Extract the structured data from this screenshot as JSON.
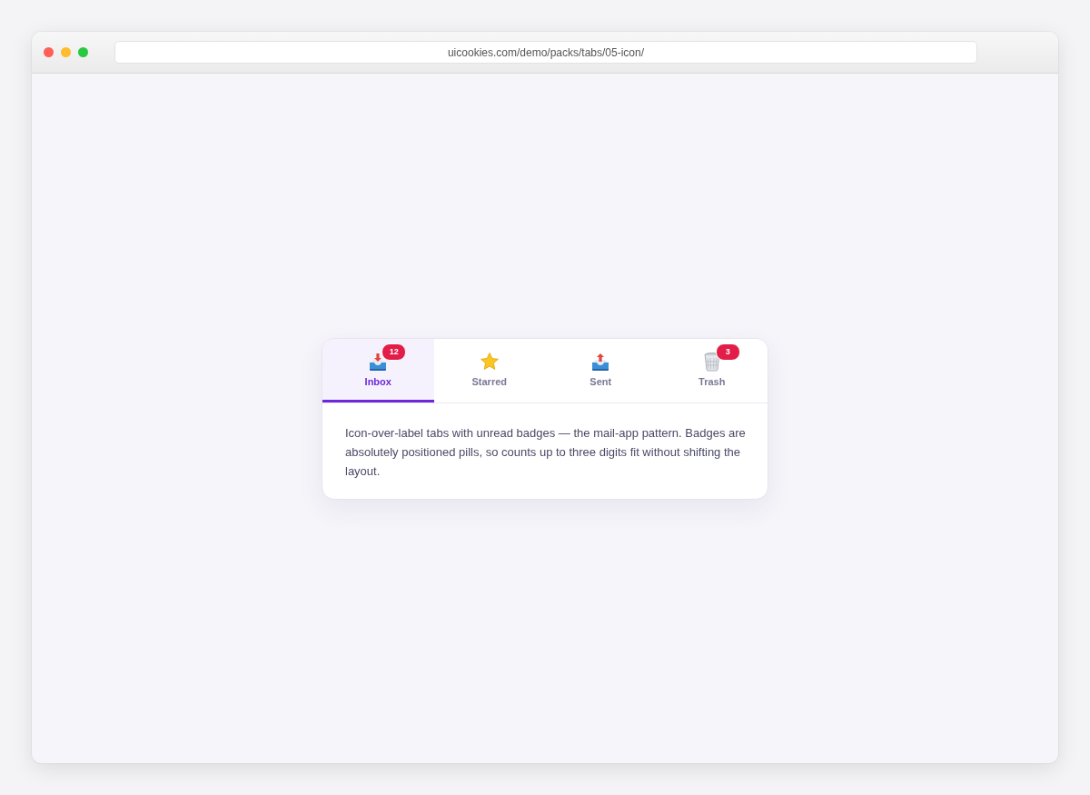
{
  "browser": {
    "url": "uicookies.com/demo/packs/tabs/05-icon/"
  },
  "tabs": [
    {
      "label": "Inbox",
      "selected": true,
      "badge": "12"
    },
    {
      "label": "Starred",
      "selected": false
    },
    {
      "label": "Sent",
      "selected": false
    },
    {
      "label": "Trash",
      "selected": false,
      "badge": "3"
    }
  ],
  "panel": {
    "text": "Icon-over-label tabs with unread badges — the mail-app pattern. Badges are absolutely positioned pills, so counts up to three digits fit without shifting the layout."
  }
}
